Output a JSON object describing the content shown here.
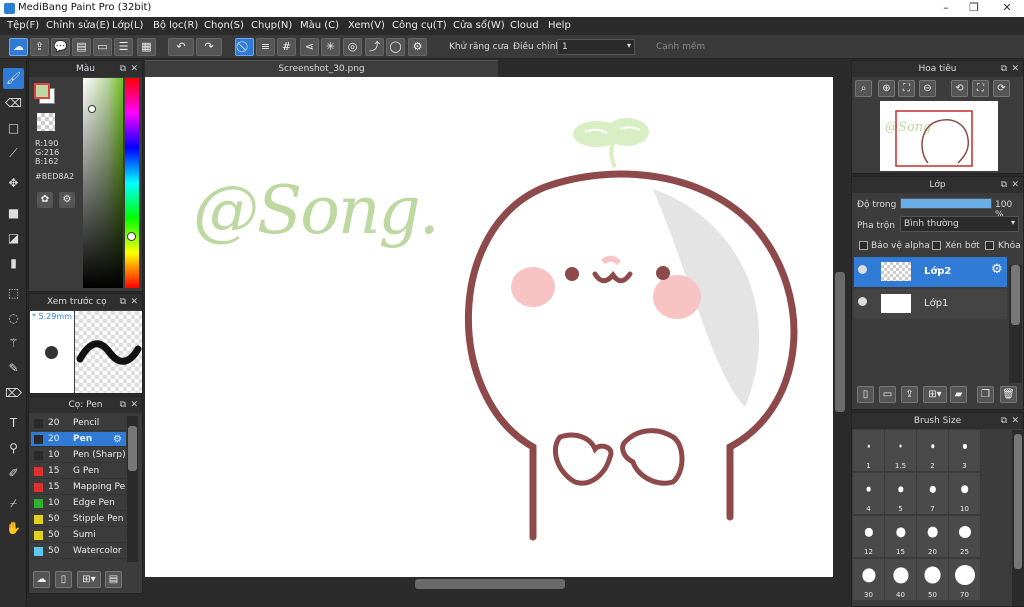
{
  "app": {
    "title": "MediBang Paint Pro (32bit)"
  },
  "menu": [
    "Tệp(F)",
    "Chỉnh sửa(E)",
    "Lớp(L)",
    "Bộ lọc(R)",
    "Chọn(S)",
    "Chụp(N)",
    "Màu (C)",
    "Xem(V)",
    "Công cụ(T)",
    "Cửa sổ(W)",
    "Cloud",
    "Help"
  ],
  "toolbar": {
    "antialias_label": "Khử răng cưa",
    "adjust_label": "Điều chỉnh",
    "adjust_value": "1",
    "soft_edge_label": "Cạnh mềm"
  },
  "color_panel": {
    "title": "Màu",
    "r": "R:190",
    "g": "G:216",
    "b": "B:162",
    "hex": "#BED8A2",
    "fg_color": "#bed8a2",
    "bg_color": "#ffffff"
  },
  "preview_panel": {
    "title": "Xem trước cọ",
    "size": "* 5.29mm"
  },
  "brush_panel": {
    "title": "Cọ: Pen",
    "items": [
      {
        "size": "20",
        "name": "Pencil",
        "color": "#2a2a2a"
      },
      {
        "size": "20",
        "name": "Pen",
        "color": "#2a2a2a"
      },
      {
        "size": "10",
        "name": "Pen (Sharp)",
        "color": "#2a2a2a"
      },
      {
        "size": "15",
        "name": "G Pen",
        "color": "#e03030"
      },
      {
        "size": "15",
        "name": "Mapping Pen",
        "color": "#e03030"
      },
      {
        "size": "10",
        "name": "Edge Pen",
        "color": "#30b030"
      },
      {
        "size": "50",
        "name": "Stipple Pen",
        "color": "#e0d020"
      },
      {
        "size": "50",
        "name": "Sumi",
        "color": "#e0d020"
      },
      {
        "size": "50",
        "name": "Watercolor",
        "color": "#60c8f0"
      }
    ]
  },
  "canvas": {
    "tab_title": "Screenshot_30.png",
    "text": "@Song."
  },
  "navigator": {
    "title": "Hoa tiêu"
  },
  "layer_panel": {
    "title": "Lớp",
    "opacity_label": "Độ trong",
    "opacity_value": "100 %",
    "opacity": 1.0,
    "blend_label": "Pha trộn",
    "blend_value": "Bình thường",
    "protect_alpha": "Bảo vệ alpha",
    "clipping": "Xén bớt",
    "lock": "Khóa",
    "layers": [
      {
        "name": "Lớp2",
        "selected": true
      },
      {
        "name": "Lớp1",
        "selected": false
      }
    ]
  },
  "brush_size_panel": {
    "title": "Brush Size",
    "sizes": [
      "1",
      "1.5",
      "2",
      "3",
      "4",
      "5",
      "7",
      "10",
      "12",
      "15",
      "20",
      "25",
      "30",
      "40",
      "50",
      "70"
    ]
  }
}
